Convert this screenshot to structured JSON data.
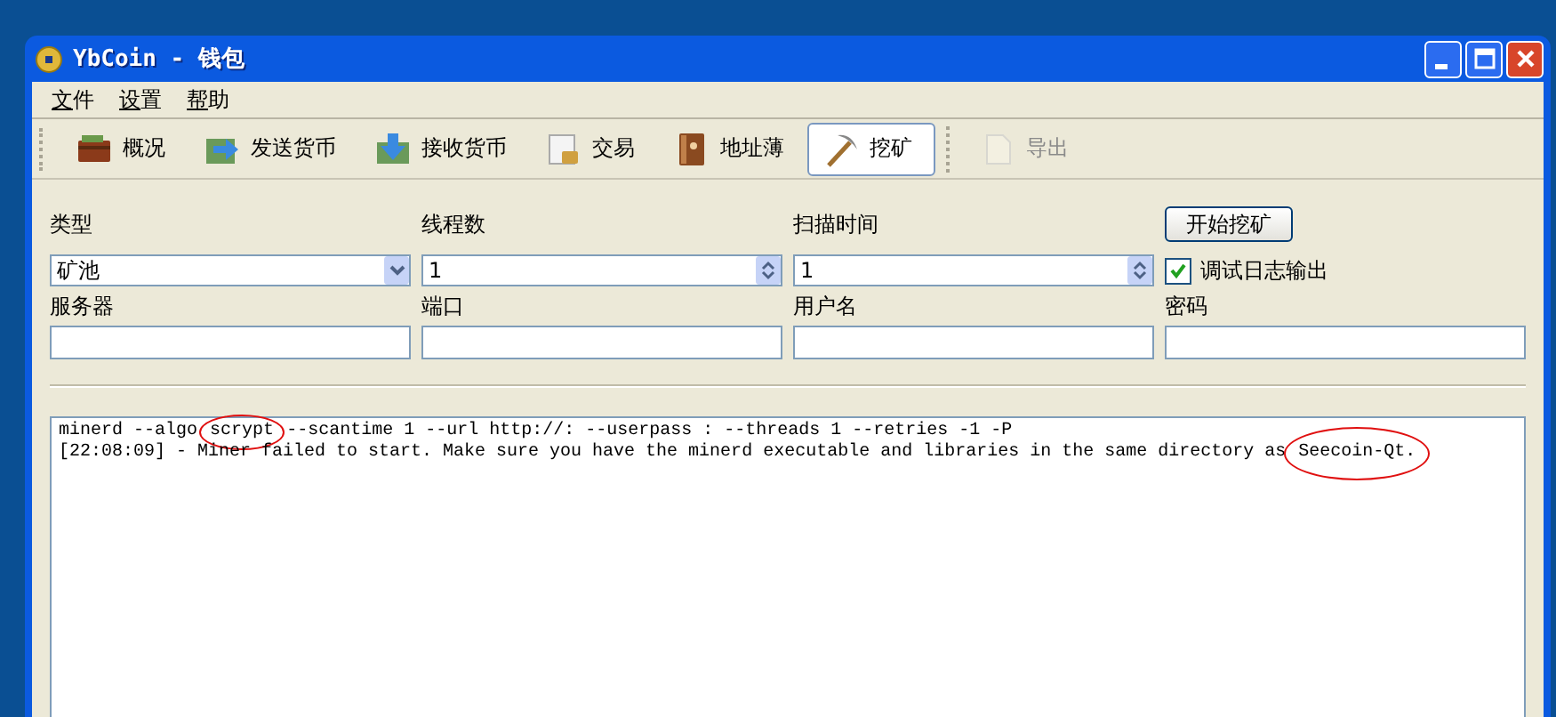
{
  "window": {
    "title": "YbCoin - 钱包"
  },
  "menu": [
    "文件",
    "设置",
    "帮助"
  ],
  "toolbar": [
    {
      "label": "概况",
      "selected": false,
      "disabled": false
    },
    {
      "label": "发送货币",
      "selected": false,
      "disabled": false
    },
    {
      "label": "接收货币",
      "selected": false,
      "disabled": false
    },
    {
      "label": "交易",
      "selected": false,
      "disabled": false
    },
    {
      "label": "地址薄",
      "selected": false,
      "disabled": false
    },
    {
      "label": "挖矿",
      "selected": true,
      "disabled": false
    },
    {
      "label": "导出",
      "selected": false,
      "disabled": true
    }
  ],
  "form": {
    "row1": [
      {
        "label": "类型",
        "kind": "combo",
        "value": "矿池"
      },
      {
        "label": "线程数",
        "kind": "spin",
        "value": "1"
      },
      {
        "label": "扫描时间",
        "kind": "spin",
        "value": "1"
      }
    ],
    "start_button": "开始挖矿",
    "debug_checkbox": {
      "label": "调试日志输出",
      "checked": true
    },
    "row2": [
      {
        "label": "服务器",
        "kind": "text"
      },
      {
        "label": "端口",
        "kind": "text"
      },
      {
        "label": "用户名",
        "kind": "text"
      },
      {
        "label": "密码",
        "kind": "text"
      }
    ]
  },
  "log": [
    {
      "segments": [
        {
          "text": "minerd --algo",
          "circled": false
        },
        {
          "text": "scrypt",
          "circled": true
        },
        {
          "text": "--scantime 1 --url http://: --userpass : --threads 1 --retries -1 -P",
          "circled": false
        }
      ]
    },
    {
      "segments": [
        {
          "text": "[22:08:09] - Miner failed to start. Make sure you have the minerd executable and libraries in the same directory as",
          "circled": false
        },
        {
          "text": "Seecoin-Qt.",
          "circled": true
        }
      ]
    }
  ]
}
